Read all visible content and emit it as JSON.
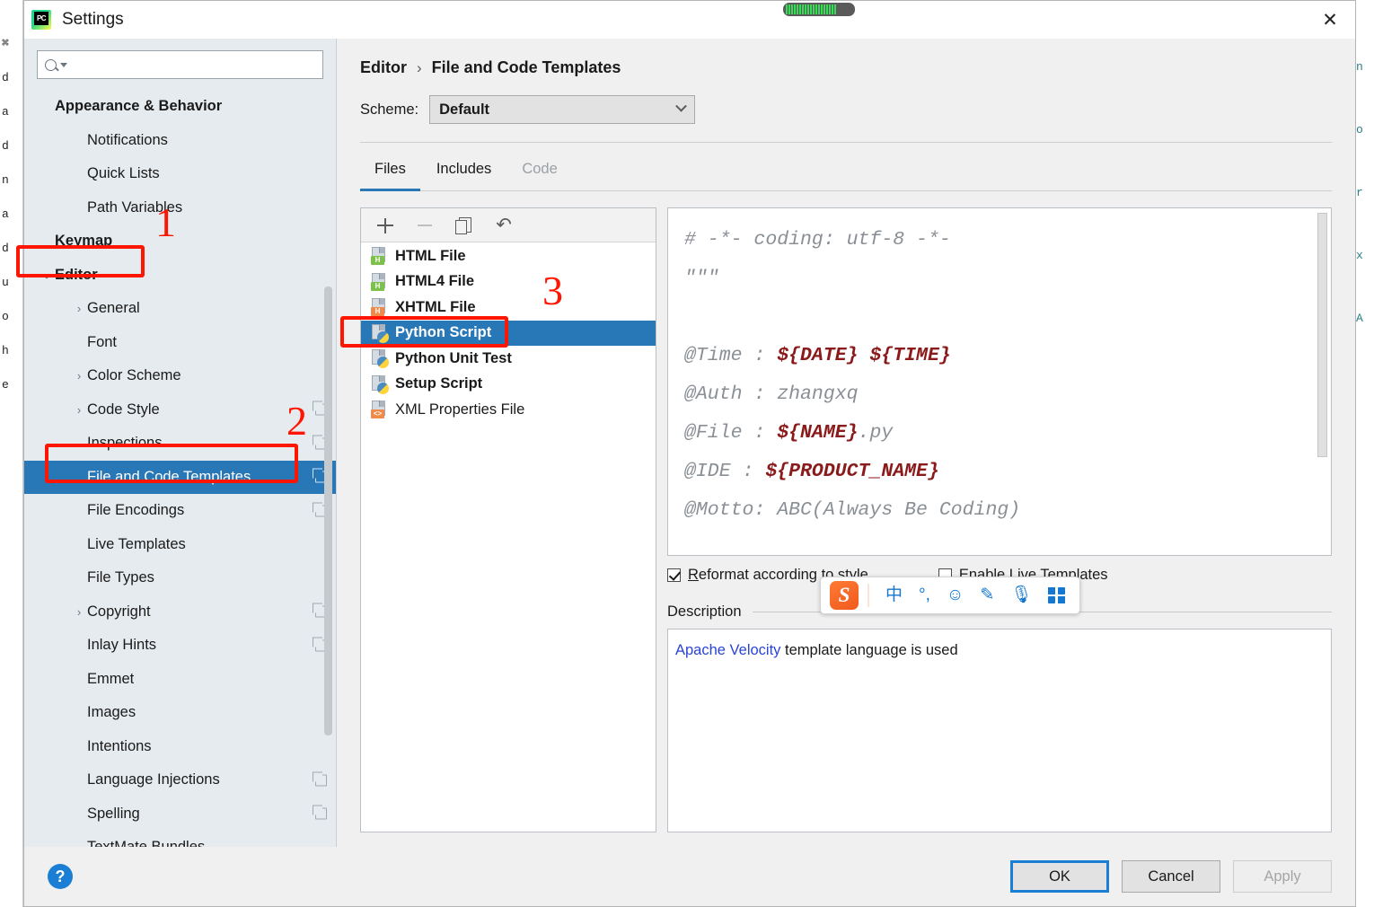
{
  "window": {
    "title": "Settings",
    "logo_icon": "pycharm-logo-icon",
    "close_icon": "close-icon",
    "cpu_meter_segments": 19
  },
  "sidebar": {
    "search": {
      "value": "",
      "placeholder": "",
      "icon": "search-icon"
    },
    "items": [
      {
        "label": "Appearance & Behavior",
        "type": "group",
        "indent": 0,
        "twisty": "",
        "copy_badge": false
      },
      {
        "label": "Notifications",
        "type": "leaf",
        "indent": 1,
        "twisty": "",
        "copy_badge": false
      },
      {
        "label": "Quick Lists",
        "type": "leaf",
        "indent": 1,
        "twisty": "",
        "copy_badge": false
      },
      {
        "label": "Path Variables",
        "type": "leaf",
        "indent": 1,
        "twisty": "",
        "copy_badge": false
      },
      {
        "label": "Keymap",
        "type": "group",
        "indent": 0,
        "twisty": "",
        "copy_badge": false
      },
      {
        "label": "Editor",
        "type": "group",
        "indent": 0,
        "twisty": "⌄",
        "copy_badge": false
      },
      {
        "label": "General",
        "type": "leaf",
        "indent": 1,
        "twisty": "›",
        "copy_badge": false
      },
      {
        "label": "Font",
        "type": "leaf",
        "indent": 1,
        "twisty": "",
        "copy_badge": false
      },
      {
        "label": "Color Scheme",
        "type": "leaf",
        "indent": 1,
        "twisty": "›",
        "copy_badge": false
      },
      {
        "label": "Code Style",
        "type": "leaf",
        "indent": 1,
        "twisty": "›",
        "copy_badge": true
      },
      {
        "label": "Inspections",
        "type": "leaf",
        "indent": 1,
        "twisty": "",
        "copy_badge": true
      },
      {
        "label": "File and Code Templates",
        "type": "leaf",
        "indent": 1,
        "twisty": "",
        "copy_badge": true,
        "selected": true
      },
      {
        "label": "File Encodings",
        "type": "leaf",
        "indent": 1,
        "twisty": "",
        "copy_badge": true
      },
      {
        "label": "Live Templates",
        "type": "leaf",
        "indent": 1,
        "twisty": "",
        "copy_badge": false
      },
      {
        "label": "File Types",
        "type": "leaf",
        "indent": 1,
        "twisty": "",
        "copy_badge": false
      },
      {
        "label": "Copyright",
        "type": "leaf",
        "indent": 1,
        "twisty": "›",
        "copy_badge": true
      },
      {
        "label": "Inlay Hints",
        "type": "leaf",
        "indent": 1,
        "twisty": "",
        "copy_badge": true
      },
      {
        "label": "Emmet",
        "type": "leaf",
        "indent": 1,
        "twisty": "",
        "copy_badge": false
      },
      {
        "label": "Images",
        "type": "leaf",
        "indent": 1,
        "twisty": "",
        "copy_badge": false
      },
      {
        "label": "Intentions",
        "type": "leaf",
        "indent": 1,
        "twisty": "",
        "copy_badge": false
      },
      {
        "label": "Language Injections",
        "type": "leaf",
        "indent": 1,
        "twisty": "",
        "copy_badge": true
      },
      {
        "label": "Spelling",
        "type": "leaf",
        "indent": 1,
        "twisty": "",
        "copy_badge": true
      },
      {
        "label": "TextMate Bundles",
        "type": "leaf",
        "indent": 1,
        "twisty": "",
        "copy_badge": false
      }
    ]
  },
  "main": {
    "breadcrumb": {
      "parent": "Editor",
      "separator": "›",
      "current": "File and Code Templates"
    },
    "scheme": {
      "label": "Scheme:",
      "value": "Default",
      "chevron_icon": "chevron-down-icon"
    },
    "tabs": [
      {
        "label": "Files",
        "state": "active"
      },
      {
        "label": "Includes",
        "state": "normal"
      },
      {
        "label": "Code",
        "state": "disabled"
      }
    ],
    "file_toolbar": [
      {
        "name": "add-template-button",
        "icon": "plus-icon",
        "enabled": true
      },
      {
        "name": "remove-template-button",
        "icon": "minus-icon",
        "enabled": false
      },
      {
        "name": "copy-template-button",
        "icon": "copy-icon",
        "enabled": true
      },
      {
        "name": "reset-template-button",
        "icon": "undo-icon",
        "enabled": true
      }
    ],
    "file_list": [
      {
        "label": "HTML File",
        "icon": "html-file-icon",
        "bold": true,
        "selected": false
      },
      {
        "label": "HTML4 File",
        "icon": "html-file-icon",
        "bold": true,
        "selected": false
      },
      {
        "label": "XHTML File",
        "icon": "xhtml-file-icon",
        "bold": true,
        "selected": false
      },
      {
        "label": "Python Script",
        "icon": "python-file-icon",
        "bold": true,
        "selected": true
      },
      {
        "label": "Python Unit Test",
        "icon": "python-file-icon",
        "bold": true,
        "selected": false
      },
      {
        "label": "Setup Script",
        "icon": "python-file-icon",
        "bold": true,
        "selected": false
      },
      {
        "label": "XML Properties File",
        "icon": "xml-file-icon",
        "bold": false,
        "selected": false
      }
    ],
    "code_lines": [
      [
        {
          "t": "# -*- coding: utf-8 -*-",
          "v": false
        }
      ],
      [
        {
          "t": "\"\"\"",
          "v": false
        }
      ],
      [
        {
          "t": "",
          "v": false
        }
      ],
      [
        {
          "t": "@Time : ",
          "v": false
        },
        {
          "t": "${DATE} ${TIME}",
          "v": true
        }
      ],
      [
        {
          "t": "@Auth : zhangxq",
          "v": false
        }
      ],
      [
        {
          "t": "@File : ",
          "v": false
        },
        {
          "t": "${NAME}",
          "v": true
        },
        {
          "t": ".py",
          "v": false
        }
      ],
      [
        {
          "t": "@IDE : ",
          "v": false
        },
        {
          "t": "${PRODUCT_NAME}",
          "v": true
        }
      ],
      [
        {
          "t": "@Motto: ABC(Always Be Coding)",
          "v": false
        }
      ],
      [
        {
          "t": "",
          "v": false
        }
      ],
      [
        {
          "t": "\"\"\"",
          "v": false
        }
      ]
    ],
    "options": [
      {
        "label": "Reformat according to style",
        "checked": true,
        "underline_index": 0,
        "name": "reformat-checkbox"
      },
      {
        "label": "Enable Live Templates",
        "checked": false,
        "underline_index": -1,
        "name": "enable-live-templates-checkbox"
      }
    ],
    "description": {
      "title": "Description",
      "link_text": "Apache Velocity",
      "rest_text": " template language is used"
    }
  },
  "sogou_toolbar": {
    "logo": "S",
    "buttons": [
      {
        "icon": "chinese-mode-icon",
        "glyph": "中"
      },
      {
        "icon": "punctuation-mode-icon",
        "glyph": "°,"
      },
      {
        "icon": "emoji-icon",
        "glyph": "☺"
      },
      {
        "icon": "handwriting-pen-icon",
        "glyph": "✎"
      },
      {
        "icon": "microphone-icon",
        "glyph": "⬤"
      },
      {
        "icon": "app-grid-icon",
        "glyph": ""
      }
    ]
  },
  "annotations": [
    {
      "number": "1",
      "target": "editor-tree-item"
    },
    {
      "number": "2",
      "target": "file-and-code-templates-tree-item"
    },
    {
      "number": "3",
      "target": "python-script-list-item"
    }
  ],
  "footer": {
    "help_icon": "help-icon",
    "buttons": [
      {
        "label": "OK",
        "style": "primary",
        "enabled": true
      },
      {
        "label": "Cancel",
        "style": "normal",
        "enabled": true
      },
      {
        "label": "Apply",
        "style": "normal",
        "enabled": false
      }
    ]
  },
  "background_edges": {
    "left_chars": [
      "⌘",
      "d",
      "a",
      "d",
      "n",
      "a",
      "d",
      "u",
      "o",
      "h",
      "e"
    ],
    "right_chars": [
      "n",
      "o",
      "r",
      "х",
      "A"
    ]
  }
}
